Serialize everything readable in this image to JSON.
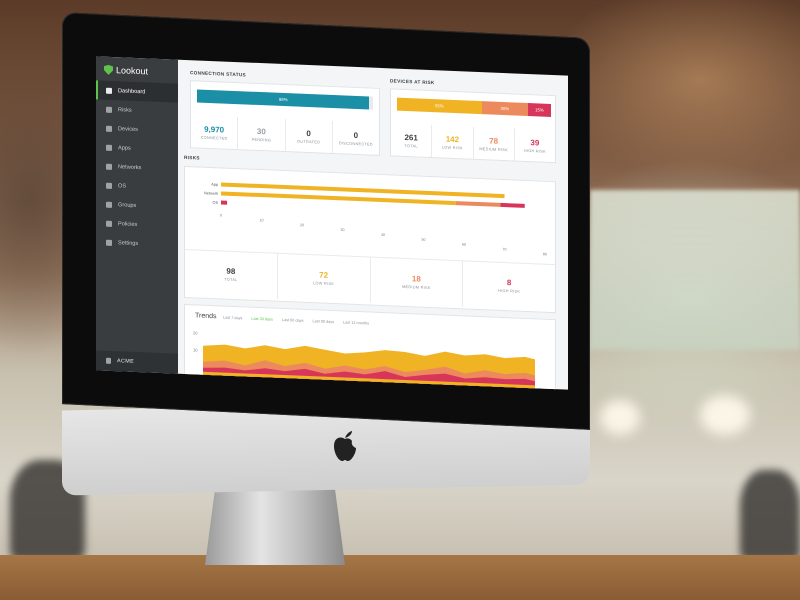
{
  "brand": {
    "name": "Lookout",
    "accent": "#5fc24d"
  },
  "sidebar": {
    "items": [
      {
        "label": "Dashboard",
        "icon": "dashboard-icon",
        "active": true
      },
      {
        "label": "Risks",
        "icon": "warning-icon"
      },
      {
        "label": "Devices",
        "icon": "device-icon"
      },
      {
        "label": "Apps",
        "icon": "apps-grid-icon"
      },
      {
        "label": "Networks",
        "icon": "wifi-icon"
      },
      {
        "label": "OS",
        "icon": "os-icon"
      },
      {
        "label": "Groups",
        "icon": "groups-icon"
      },
      {
        "label": "Policies",
        "icon": "policy-icon"
      },
      {
        "label": "Settings",
        "icon": "gear-icon"
      }
    ],
    "user": "ACME"
  },
  "connection_status": {
    "title": "CONNECTION STATUS",
    "bar_percent": 98,
    "bar_label": "98%",
    "stats": [
      {
        "value": "9,970",
        "label": "CONNECTED",
        "color": "#1b8fa6"
      },
      {
        "value": "30",
        "label": "PENDING",
        "color": "#9aa0a5"
      },
      {
        "value": "0",
        "label": "OUTDATED",
        "color": "#3b3f43"
      },
      {
        "value": "0",
        "label": "DISCONNECTED",
        "color": "#3b3f43"
      }
    ]
  },
  "devices_at_risk": {
    "title": "DEVICES AT RISK",
    "segments": [
      {
        "label": "55%",
        "fraction": 0.55,
        "color": "#f0b323"
      },
      {
        "label": "30%",
        "fraction": 0.3,
        "color": "#ec8a5d"
      },
      {
        "label": "15%",
        "fraction": 0.15,
        "color": "#d7365a"
      }
    ],
    "stats": [
      {
        "value": "261",
        "label": "TOTAL",
        "color": "#3b3f43"
      },
      {
        "value": "142",
        "label": "LOW RISK",
        "color": "#f0b323"
      },
      {
        "value": "78",
        "label": "MEDIUM RISK",
        "color": "#ec8a5d"
      },
      {
        "value": "39",
        "label": "HIGH RISK",
        "color": "#d7365a"
      }
    ]
  },
  "risks": {
    "title": "RISKS",
    "rows": [
      {
        "label": "App",
        "low": 70,
        "medium": 0,
        "high": 0
      },
      {
        "label": "Network",
        "low": 58,
        "medium": 11,
        "high": 6
      },
      {
        "label": "OS",
        "low": 0,
        "medium": 0,
        "high": 1.5
      }
    ],
    "axis_ticks": [
      "0",
      "10",
      "20",
      "30",
      "40",
      "50",
      "60",
      "70",
      "80"
    ],
    "stats": [
      {
        "value": "98",
        "label": "TOTAL",
        "color": "#3b3f43"
      },
      {
        "value": "72",
        "label": "LOW RISK",
        "color": "#f0b323"
      },
      {
        "value": "18",
        "label": "MEDIUM RISK",
        "color": "#ec8a5d"
      },
      {
        "value": "8",
        "label": "HIGH RISK",
        "color": "#d7365a"
      }
    ]
  },
  "trends": {
    "title": "Trends",
    "tabs": [
      "Last 7 days",
      "Last 30 days",
      "Last 60 days",
      "Last 90 days",
      "Last 12 months"
    ],
    "active_tab": 1,
    "y_ticks": [
      "20",
      "10"
    ]
  },
  "colors": {
    "low": "#f0b323",
    "medium": "#ec8a5d",
    "high": "#d7365a",
    "connected": "#1b8fa6"
  }
}
